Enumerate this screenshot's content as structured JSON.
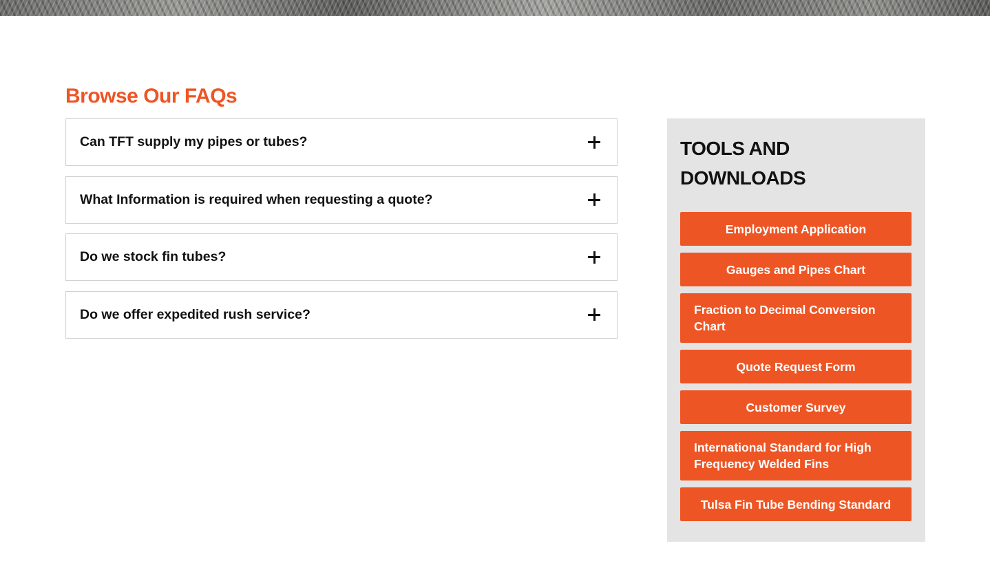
{
  "faq": {
    "title": "Browse Our FAQs",
    "items": [
      {
        "question": "Can TFT supply my pipes or tubes?"
      },
      {
        "question": "What Information is required when requesting a quote?"
      },
      {
        "question": "Do we stock fin tubes?"
      },
      {
        "question": "Do we offer expedited rush service?"
      }
    ]
  },
  "sidebar": {
    "title_line1": "TOOLS AND",
    "title_line2": "DOWNLOADS",
    "buttons": [
      {
        "label": "Employment Application"
      },
      {
        "label": "Gauges and Pipes Chart"
      },
      {
        "label": "Fraction to Decimal Conversion Chart"
      },
      {
        "label": "Quote Request Form"
      },
      {
        "label": "Customer Survey"
      },
      {
        "label": "International Standard for High Frequency Welded Fins"
      },
      {
        "label": "Tulsa Fin Tube Bending Standard"
      }
    ]
  },
  "colors": {
    "accent": "#ee5524",
    "sidebar_bg": "#e4e4e4",
    "border": "#d2d2d2"
  },
  "icons": {
    "expand": "plus-icon"
  }
}
